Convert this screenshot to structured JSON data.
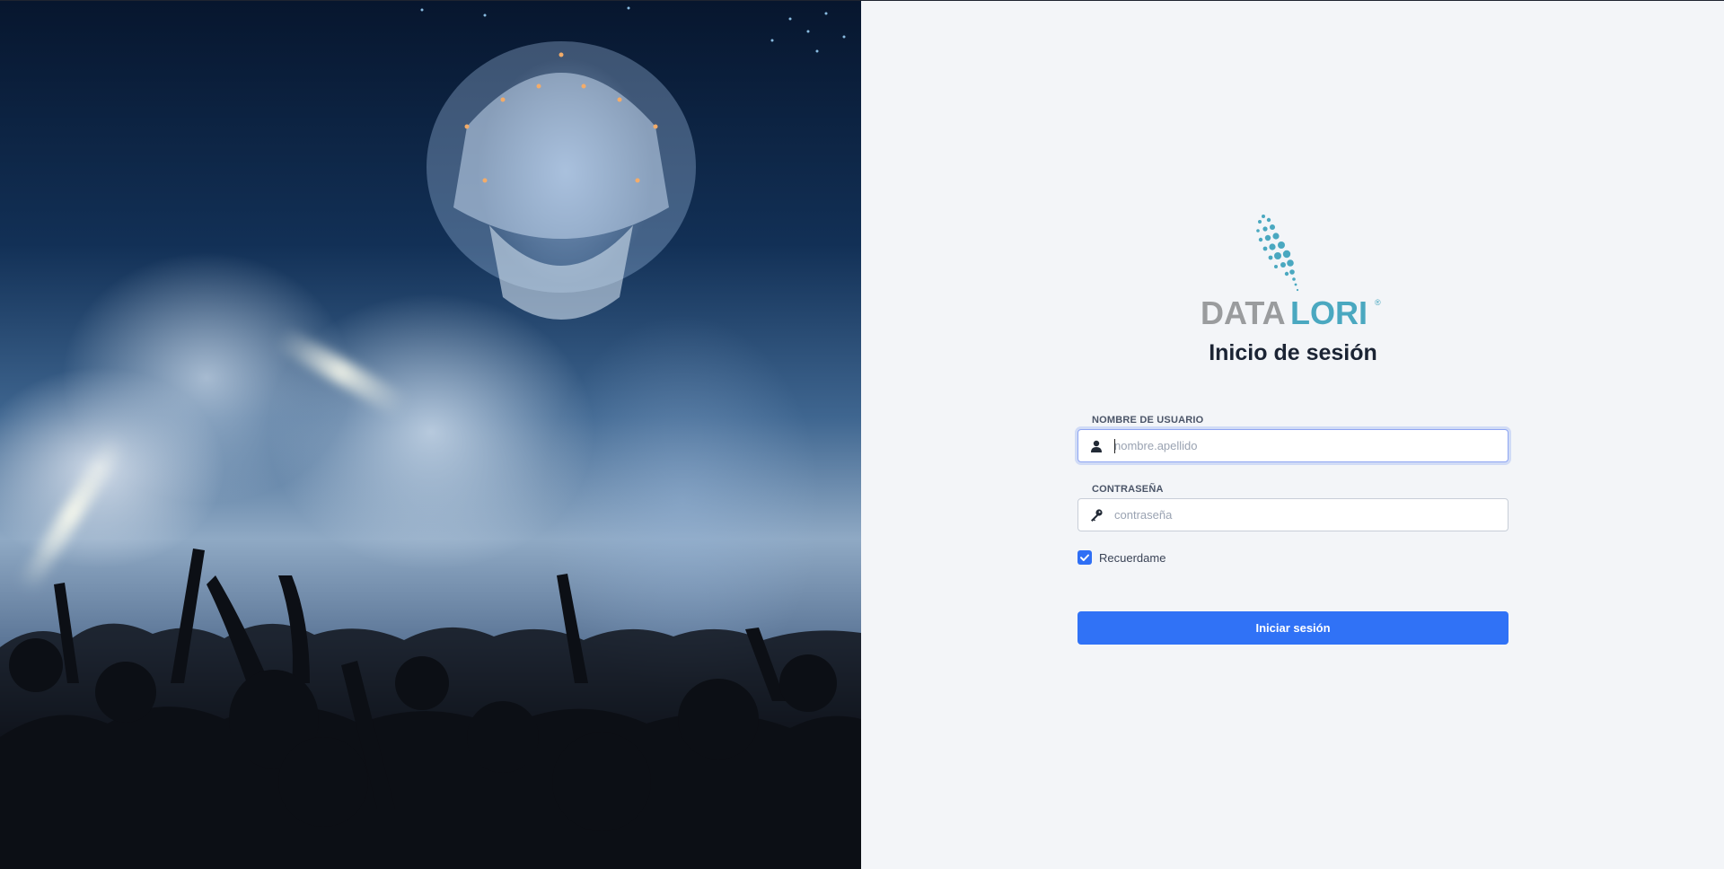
{
  "brand": {
    "wordmark_part1": "DATA",
    "wordmark_part2": "LORI",
    "registered": "®",
    "colors": {
      "gray": "#9a9c9e",
      "teal": "#4aa8c0"
    }
  },
  "login": {
    "title": "Inicio de sesión",
    "username": {
      "label": "NOMBRE DE USUARIO",
      "placeholder": "nombre.apellido",
      "value": "",
      "icon": "user-icon"
    },
    "password": {
      "label": "CONTRASEÑA",
      "placeholder": "contraseña",
      "value": "",
      "icon": "key-icon"
    },
    "remember": {
      "label": "Recuerdame",
      "checked": true
    },
    "submit_label": "Iniciar sesión"
  },
  "colors": {
    "accent": "#3072f6",
    "background": "#f3f5f8",
    "text": "#1b2434"
  }
}
